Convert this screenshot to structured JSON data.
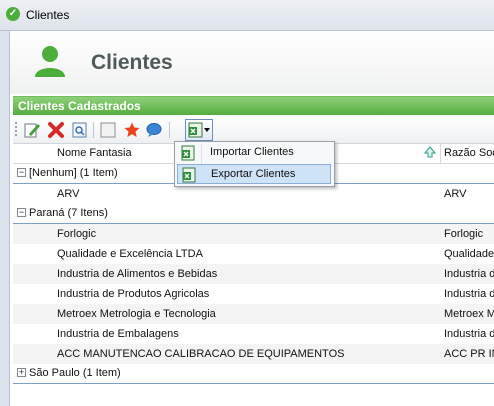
{
  "window": {
    "title": "Clientes"
  },
  "header": {
    "title": "Clientes"
  },
  "grid": {
    "caption": "Clientes Cadastrados",
    "columns": {
      "nome_fantasia": "Nome Fantasia",
      "razao_social": "Razão Soc"
    }
  },
  "menu": {
    "items": [
      "Importar Clientes",
      "Exportar Clientes"
    ],
    "highlighted": "Exportar Clientes"
  },
  "groups": [
    {
      "label": "[Nenhum] (1 Item)",
      "expanded": true,
      "rows": [
        {
          "nome_fantasia": "ARV",
          "razao_social": "ARV"
        }
      ]
    },
    {
      "label": "Paraná (7 Itens)",
      "expanded": true,
      "rows": [
        {
          "nome_fantasia": "Forlogic",
          "razao_social": "Forlogic"
        },
        {
          "nome_fantasia": "Qualidade e Excelência LTDA",
          "razao_social": "Qualidade"
        },
        {
          "nome_fantasia": "Industria de Alimentos e Bebidas",
          "razao_social": "Industria de"
        },
        {
          "nome_fantasia": "Industria de Produtos Agricolas",
          "razao_social": "Industria de"
        },
        {
          "nome_fantasia": "Metroex Metrologia e Tecnologia",
          "razao_social": "Metroex Me"
        },
        {
          "nome_fantasia": "Industria de Embalagens",
          "razao_social": "Industria de"
        },
        {
          "nome_fantasia": "ACC MANUTENCAO CALIBRACAO DE EQUIPAMENTOS",
          "razao_social": "ACC PR IN"
        }
      ]
    },
    {
      "label": "São Paulo (1 Item)",
      "expanded": false,
      "rows": []
    }
  ],
  "colors": {
    "accent": "#55ad3d",
    "highlight": "#cfe3f8"
  },
  "toolbar_icons": [
    "edit-icon",
    "delete-icon",
    "preview-icon",
    "blank-icon",
    "favorite-icon",
    "comment-icon",
    "excel-export-icon"
  ]
}
